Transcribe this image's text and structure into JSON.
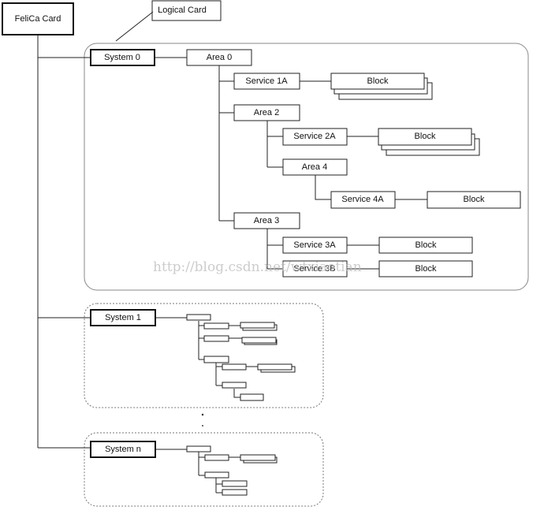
{
  "root": {
    "label": "FeliCa Card"
  },
  "callout": {
    "label": "Logical Card"
  },
  "system0": {
    "label": "System 0",
    "area0": "Area 0",
    "service1a": "Service 1A",
    "area2": "Area 2",
    "service2a": "Service 2A",
    "area4": "Area 4",
    "service4a": "Service 4A",
    "area3": "Area 3",
    "service3a": "Service 3A",
    "service3b": "Service 3B",
    "block": "Block"
  },
  "system1": {
    "label": "System 1"
  },
  "systemn": {
    "label": "System n"
  },
  "watermark": "http://blog.csdn.net/wtxiaotian"
}
